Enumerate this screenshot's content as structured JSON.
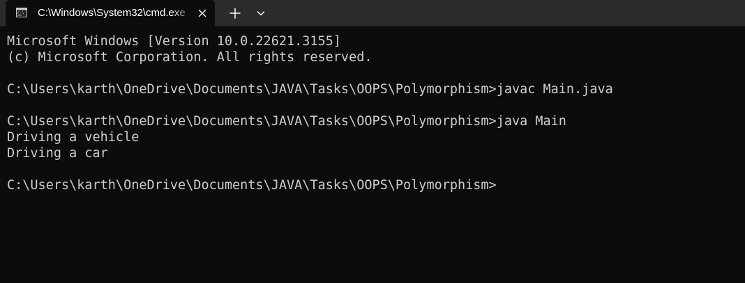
{
  "tabs": [
    {
      "title": "C:\\Windows\\System32\\cmd.exe"
    }
  ],
  "icons": {
    "tab_icon": "console-icon",
    "close": "close-icon",
    "new_tab": "plus-icon",
    "dropdown": "chevron-down-icon"
  },
  "colors": {
    "background": "#0c0c0c",
    "tabstrip": "#2b2b2b",
    "foreground": "#cccccc"
  },
  "console": {
    "lines": [
      "Microsoft Windows [Version 10.0.22621.3155]",
      "(c) Microsoft Corporation. All rights reserved.",
      "",
      "C:\\Users\\karth\\OneDrive\\Documents\\JAVA\\Tasks\\OOPS\\Polymorphism>javac Main.java",
      "",
      "C:\\Users\\karth\\OneDrive\\Documents\\JAVA\\Tasks\\OOPS\\Polymorphism>java Main",
      "Driving a vehicle",
      "Driving a car",
      "",
      "C:\\Users\\karth\\OneDrive\\Documents\\JAVA\\Tasks\\OOPS\\Polymorphism>"
    ]
  }
}
